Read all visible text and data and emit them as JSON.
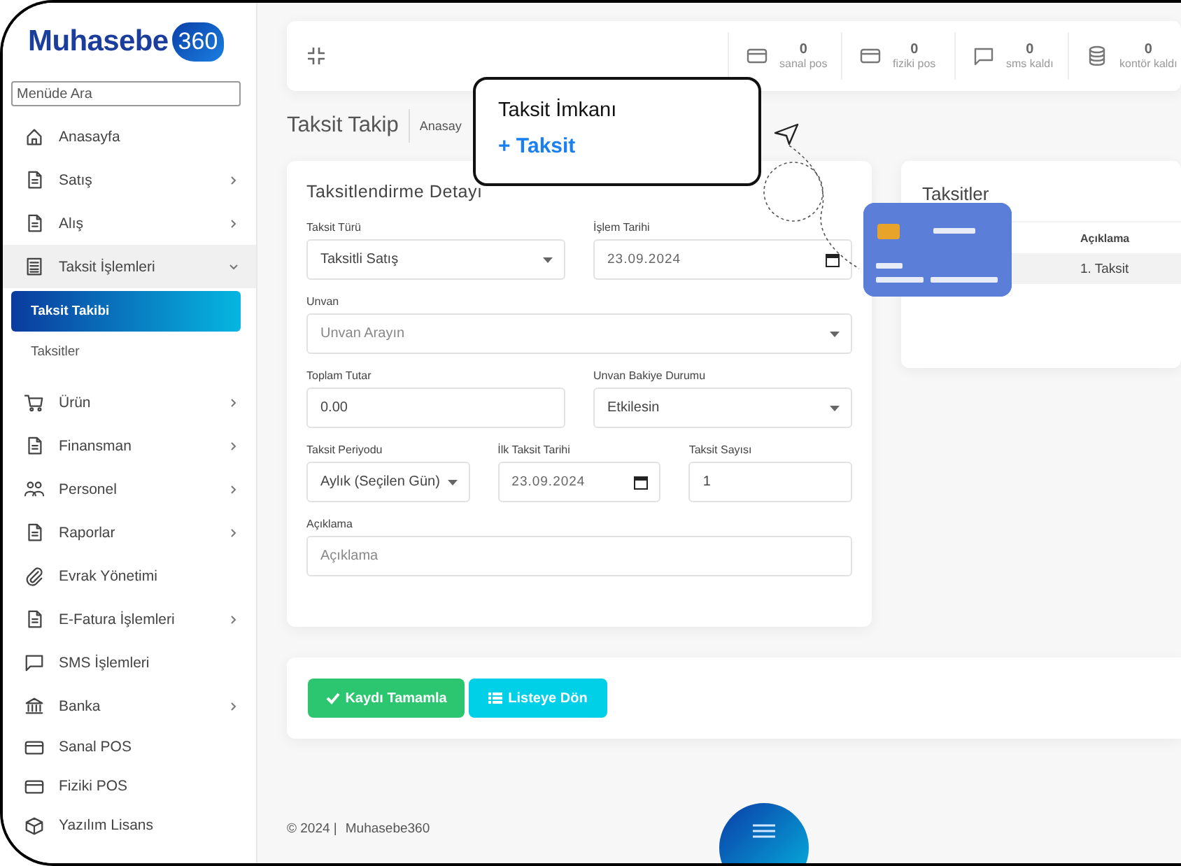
{
  "logo": {
    "name": "Muhasebe",
    "badge": "360"
  },
  "sidebar": {
    "search": {
      "placeholder": "Menüde Ara"
    },
    "items": [
      {
        "kind": "home",
        "label": "Anasayfa",
        "submenu": false
      },
      {
        "kind": "document",
        "label": "Satış",
        "submenu": true,
        "expanded": false
      },
      {
        "kind": "document",
        "label": "Alış",
        "submenu": true,
        "expanded": false
      },
      {
        "kind": "ledger",
        "label": "Taksit İşlemleri",
        "submenu": true,
        "expanded": true,
        "children": [
          {
            "label": "Taksit Takibi",
            "selected": true
          },
          {
            "label": "Taksitler",
            "selected": false
          }
        ]
      },
      {
        "kind": "cart",
        "label": "Ürün",
        "submenu": true,
        "expanded": false
      },
      {
        "kind": "document",
        "label": "Finansman",
        "submenu": true,
        "expanded": false
      },
      {
        "kind": "people",
        "label": "Personel",
        "submenu": true,
        "expanded": false
      },
      {
        "kind": "document",
        "label": "Raporlar",
        "submenu": true,
        "expanded": false
      },
      {
        "kind": "clip",
        "label": "Evrak Yönetimi",
        "submenu": false
      },
      {
        "kind": "document",
        "label": "E-Fatura İşlemleri",
        "submenu": true,
        "expanded": false
      },
      {
        "kind": "chat",
        "label": "SMS İşlemleri",
        "submenu": false
      },
      {
        "kind": "bank",
        "label": "Banka",
        "submenu": true,
        "expanded": false
      },
      {
        "kind": "card",
        "label": "Sanal POS",
        "submenu": false
      },
      {
        "kind": "card",
        "label": "Fiziki POS",
        "submenu": false
      },
      {
        "kind": "box",
        "label": "Yazılım Lisans",
        "submenu": false
      }
    ]
  },
  "top_bar": {
    "stats": [
      {
        "kind": "card",
        "value": "0",
        "label": "sanal pos"
      },
      {
        "kind": "card",
        "value": "0",
        "label": "fiziki pos"
      },
      {
        "kind": "chat",
        "value": "0",
        "label": "sms kaldı"
      },
      {
        "kind": "database",
        "value": "0",
        "label": "kontör kaldı"
      }
    ]
  },
  "page": {
    "title": "Taksit Takip",
    "breadcrumb": "Anasay"
  },
  "callout": {
    "title": "Taksit İmkanı",
    "link": "+ Taksit"
  },
  "form": {
    "title": "Taksitlendirme Detayı",
    "rows": [
      [
        {
          "kind": "select",
          "label": "Taksit Türü",
          "value": "Taksitli Satış"
        },
        {
          "kind": "date",
          "label": "İşlem Tarihi",
          "value": "23.09.2024"
        }
      ],
      [
        {
          "kind": "select",
          "label": "Unvan",
          "placeholder": "Unvan Arayın"
        }
      ],
      [
        {
          "kind": "input",
          "label": "Toplam Tutar",
          "value": "0.00"
        },
        {
          "kind": "select",
          "label": "Unvan Bakiye Durumu",
          "value": "Etkilesin"
        }
      ],
      [
        {
          "kind": "select",
          "label": "Taksit Periyodu",
          "value": "Aylık (Seçilen Gün)"
        },
        {
          "kind": "date",
          "label": "İlk Taksit Tarihi",
          "value": "23.09.2024"
        },
        {
          "kind": "input",
          "label": "Taksit Sayısı",
          "value": "1"
        }
      ],
      [
        {
          "kind": "input",
          "label": "Açıklama",
          "placeholder": "Açıklama"
        }
      ]
    ]
  },
  "installments": {
    "title": "Taksitler",
    "columns": [
      "Açıklama"
    ],
    "rows": [
      [
        "1. Taksit"
      ]
    ]
  },
  "actions": [
    {
      "kind": "save",
      "label": "Kaydı Tamamla"
    },
    {
      "kind": "list",
      "label": "Listeye Dön"
    }
  ],
  "footer": {
    "copyright": "© 2024 |",
    "brand": "Muhasebe360"
  }
}
